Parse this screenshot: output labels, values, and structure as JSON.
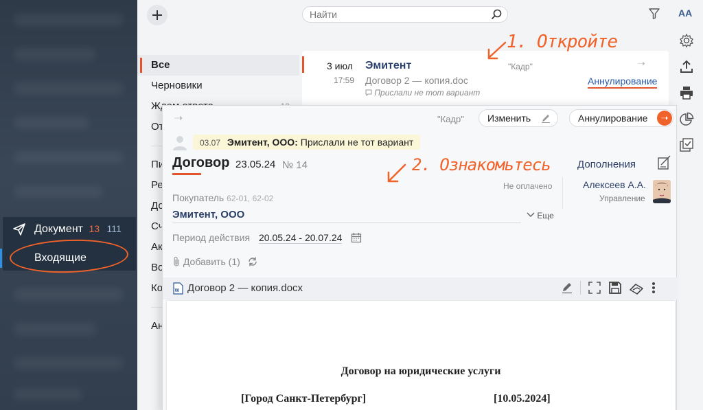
{
  "nav": {
    "docs_label": "Документ",
    "docs_count_new": "13",
    "docs_count_total": "111",
    "inbox_label": "Входящие"
  },
  "search": {
    "placeholder": "Найти"
  },
  "toolbar": {
    "font_size_label": "AA"
  },
  "folders": {
    "all": "Все",
    "drafts": "Черновики",
    "waiting": "Ждем ответа",
    "waiting_count": "10",
    "sent": "От",
    "f1": "Пи",
    "f2": "Ре",
    "f3": "До",
    "f4": "Сч",
    "f5": "Ак",
    "f6": "Во",
    "f7": "Ко",
    "f8": "Ан"
  },
  "list_item": {
    "date": "3 июл",
    "time": "17:59",
    "sender": "Эмитент",
    "doc": "Договор 2 — копия.doc",
    "comment": "Прислали не тот вариант",
    "kadr": "\"Кадр\"",
    "status": "Аннулирование"
  },
  "annotations": {
    "step1": "1. Откройте",
    "step2": "2. Ознакомьтесь"
  },
  "card": {
    "kadr": "\"Кадр\"",
    "edit_label": "Изменить",
    "annul_label": "Аннулирование",
    "comment_date": "03.07",
    "comment_author": "Эмитент, ООО:",
    "comment_text": "Прислали не тот вариант",
    "title": "Договор",
    "date": "23.05.24",
    "number": "№ 14",
    "supplements": "Дополнения",
    "payment_status": "Не оплачено",
    "person_name": "Алексеев А.А.",
    "person_dept": "Управление",
    "buyer_label": "Покупатель",
    "buyer_codes": "62-01, 62-02",
    "buyer": "Эмитент, ООО",
    "more_label": "Еще",
    "period_label": "Период действия",
    "period": "20.05.24 - 20.07.24",
    "add_label": "Добавить (1)",
    "file_name": "Договор 2 — копия.docx"
  },
  "doc_preview": {
    "heading": "Договор на юридические услуги",
    "city": "[Город Санкт-Петербург]",
    "date": "[10.05.2024]"
  },
  "colors": {
    "accent": "#e2542b",
    "annotation": "#f0622a",
    "link": "#2b5aa8",
    "nav_bg": "#323e4d"
  }
}
